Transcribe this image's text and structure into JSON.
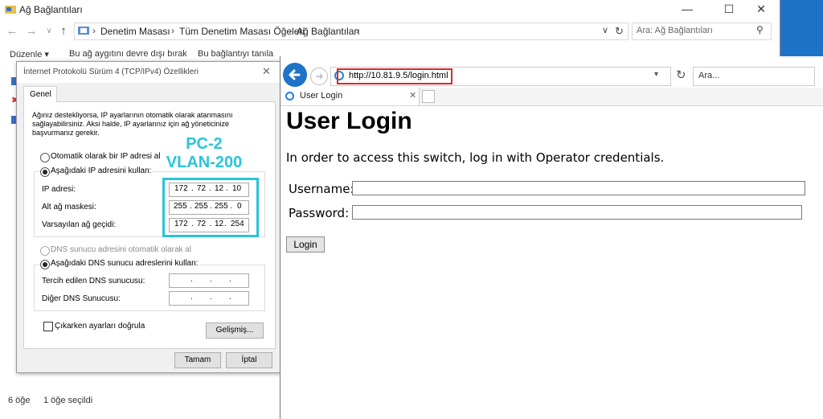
{
  "explorer": {
    "title": "Ağ Bağlantıları",
    "window_buttons": [
      "—",
      "☐",
      "✕"
    ],
    "breadcrumbs": [
      "Denetim Masası",
      "Tüm Denetim Masası Öğeleri",
      "Ağ Bağlantıları"
    ],
    "search_placeholder": "Ara: Ağ Bağlantıları",
    "ribbon": [
      "Düzenle ▾",
      "Bu ağ aygıtını devre dışı bırak",
      "Bu bağlantıyı tanıla"
    ],
    "status_items": "6 öğe",
    "status_selected": "1 öğe seçildi"
  },
  "dialog": {
    "title": "İnternet Protokolü Sürüm 4 (TCP/IPv4) Özellikleri",
    "tab": "Genel",
    "description": "Ağınız destekliyorsa, IP ayarlarının otomatik olarak atanmasını sağlayabilirsiniz. Aksi halde, IP ayarlarınız için ağ yöneticinize başvurmanız gerekir.",
    "radio_auto_ip": "Otomatik olarak bir IP adresi al",
    "radio_manual_ip": "Aşağıdaki IP adresini kullan:",
    "ip_label": "IP adresi:",
    "mask_label": "Alt ağ maskesi:",
    "gateway_label": "Varsayılan ağ geçidi:",
    "ip": [
      "172",
      "72",
      "12",
      "10"
    ],
    "mask": [
      "255",
      "255",
      "255",
      "0"
    ],
    "gateway": [
      "172",
      "72",
      "12",
      "254"
    ],
    "radio_auto_dns": "DNS sunucu adresini otomatik olarak al",
    "radio_manual_dns": "Aşağıdaki DNS sunucu adreslerini kullan:",
    "dns_pref_label": "Tercih edilen DNS sunucusu:",
    "dns_alt_label": "Diğer DNS Sunucusu:",
    "validate_label": "Çıkarken ayarları doğrula",
    "advanced_button": "Gelişmiş...",
    "ok_button": "Tamam",
    "cancel_button": "İptal"
  },
  "annotation": {
    "line1": "PC-2",
    "line2": "VLAN-200",
    "color": "#29c4d8"
  },
  "ie": {
    "url": "http://10.81.9.5/login.html",
    "search_placeholder": "Ara...",
    "tab_title": "User Login",
    "page_heading": "User Login",
    "page_text": "In order to access this switch, log in with Operator credentials.",
    "username_label": "Username:",
    "password_label": "Password:",
    "login_button": "Login",
    "highlight_color": "#d62a2a"
  }
}
